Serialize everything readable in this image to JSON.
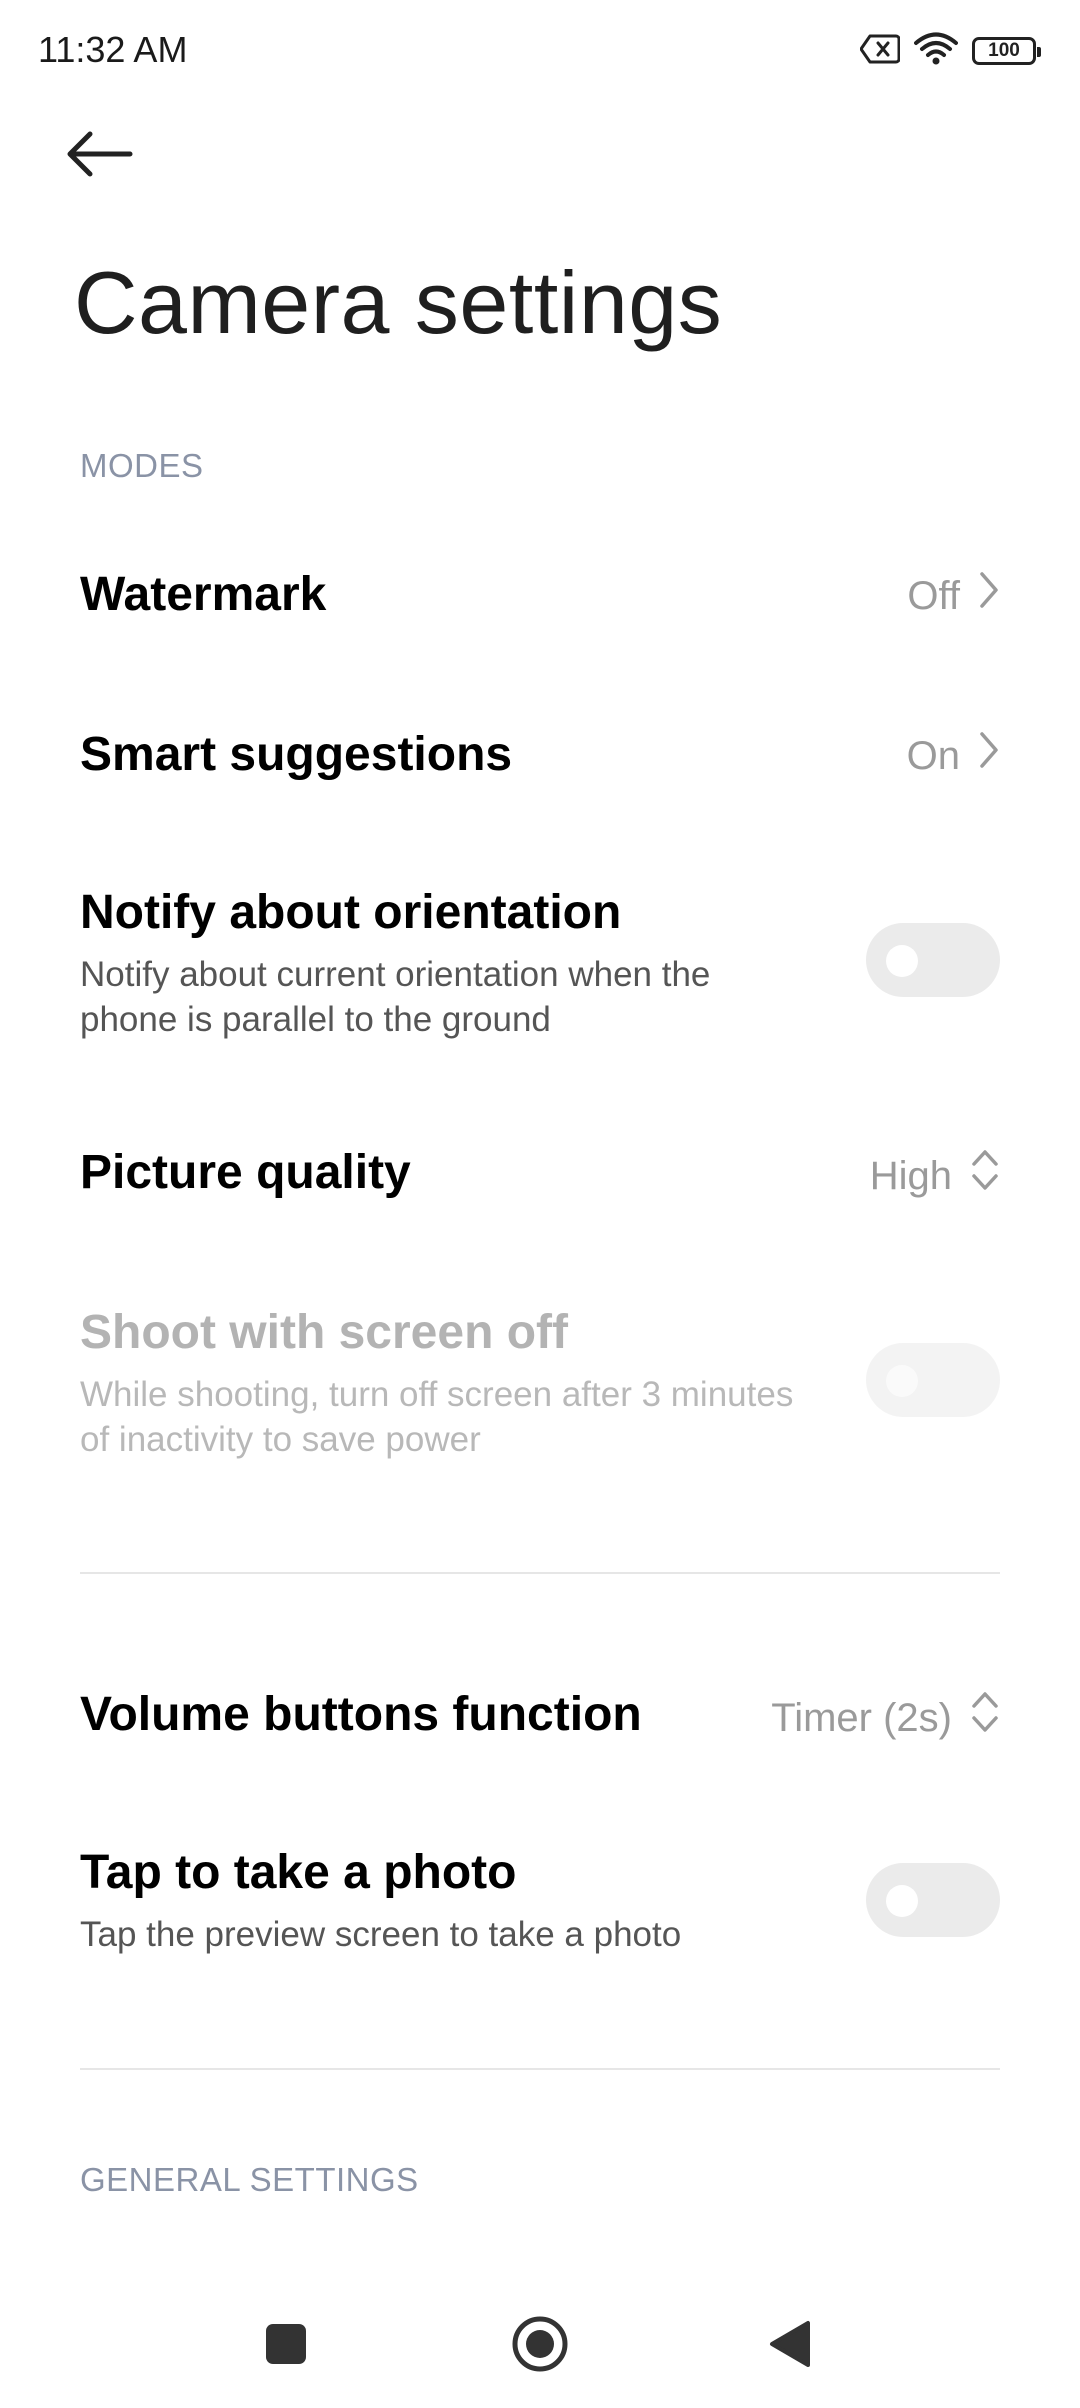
{
  "status_bar": {
    "time": "11:32 AM",
    "battery": "100"
  },
  "header": {
    "title": "Camera settings"
  },
  "sections": {
    "modes": "MODES",
    "general": "GENERAL SETTINGS"
  },
  "settings": {
    "watermark": {
      "title": "Watermark",
      "value": "Off"
    },
    "smart_suggestions": {
      "title": "Smart suggestions",
      "value": "On"
    },
    "notify_orientation": {
      "title": "Notify about orientation",
      "subtitle": "Notify about current orientation when the phone is parallel to the ground",
      "enabled": false
    },
    "picture_quality": {
      "title": "Picture quality",
      "value": "High"
    },
    "shoot_screen_off": {
      "title": "Shoot with screen off",
      "subtitle": "While shooting, turn off screen after 3 minutes of inactivity to save power",
      "enabled": false
    },
    "volume_buttons": {
      "title": "Volume buttons function",
      "value": "Timer (2s)"
    },
    "tap_photo": {
      "title": "Tap to take a photo",
      "subtitle": "Tap the preview screen to take a photo",
      "enabled": false
    }
  },
  "icons": {
    "back": "arrow-left-icon",
    "chevron": "chevron-right-icon",
    "updown": "chevron-up-down-icon",
    "nav_recents": "square-icon",
    "nav_home": "circle-icon",
    "nav_back": "triangle-back-icon"
  },
  "colors": {
    "section_header": "#8a93a6",
    "toggle_off": "#ebebeb",
    "value_text": "#9a9a9a"
  }
}
